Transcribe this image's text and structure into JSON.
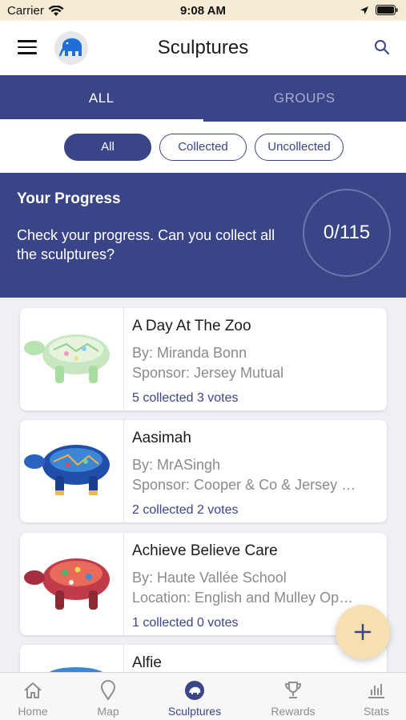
{
  "status_bar": {
    "carrier": "Carrier",
    "time": "9:08 AM"
  },
  "navbar": {
    "title": "Sculptures",
    "menu_icon": "hamburger-icon",
    "search_icon": "search-icon",
    "avatar_icon": "mammoth-icon"
  },
  "tabs": [
    {
      "label": "ALL",
      "active": true
    },
    {
      "label": "GROUPS",
      "active": false
    }
  ],
  "filters": [
    {
      "label": "All",
      "selected": true
    },
    {
      "label": "Collected",
      "selected": false
    },
    {
      "label": "Uncollected",
      "selected": false
    }
  ],
  "progress": {
    "title": "Your Progress",
    "text": "Check your progress. Can you collect all the sculptures?",
    "count": "0/115"
  },
  "sculptures": [
    {
      "name": "A Day At The Zoo",
      "by": "By: Miranda Bonn",
      "detail": "Sponsor: Jersey Mutual",
      "stats": "5 collected 3 votes"
    },
    {
      "name": "Aasimah",
      "by": "By: MrASingh",
      "detail": "Sponsor: Cooper & Co & Jersey …",
      "stats": "2 collected 2 votes"
    },
    {
      "name": "Achieve Believe Care",
      "by": "By: Haute Vallée School",
      "detail": "Location: English and Mulley Op…",
      "stats": "1 collected 0 votes"
    },
    {
      "name": "Alfie"
    }
  ],
  "fab": {
    "icon": "plus-icon"
  },
  "tabbar": [
    {
      "label": "Home",
      "icon": "home-icon",
      "active": false
    },
    {
      "label": "Map",
      "icon": "map-pin-icon",
      "active": false
    },
    {
      "label": "Sculptures",
      "icon": "sculpture-icon",
      "active": true
    },
    {
      "label": "Rewards",
      "icon": "trophy-icon",
      "active": false
    },
    {
      "label": "Stats",
      "icon": "stats-icon",
      "active": false
    }
  ],
  "colors": {
    "primary": "#3a4587",
    "status_bar": "#f6ecd6",
    "fab": "#f6dfb1",
    "background": "#eef0f5"
  }
}
